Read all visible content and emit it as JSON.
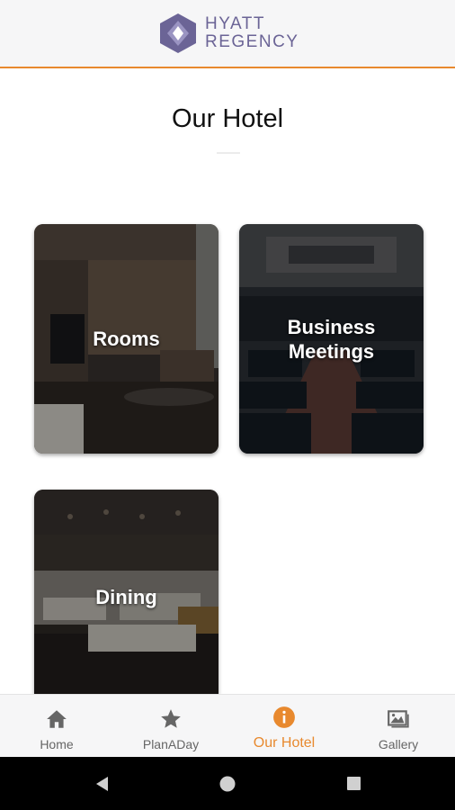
{
  "header": {
    "brand_line1": "HYATT",
    "brand_line2": "REGENCY"
  },
  "page": {
    "title": "Our Hotel"
  },
  "cards": [
    {
      "label": "Rooms"
    },
    {
      "label": "Business\nMeetings"
    },
    {
      "label": "Dining"
    }
  ],
  "tabbar": {
    "tabs": [
      {
        "label": "Home",
        "icon": "home-icon"
      },
      {
        "label": "PlanADay",
        "icon": "star-icon"
      },
      {
        "label": "Our Hotel",
        "icon": "info-icon",
        "active": true
      },
      {
        "label": "Gallery",
        "icon": "gallery-icon"
      }
    ]
  },
  "colors": {
    "accent": "#e8892e",
    "brand": "#6b6496",
    "header_bg": "#f6f6f7"
  }
}
